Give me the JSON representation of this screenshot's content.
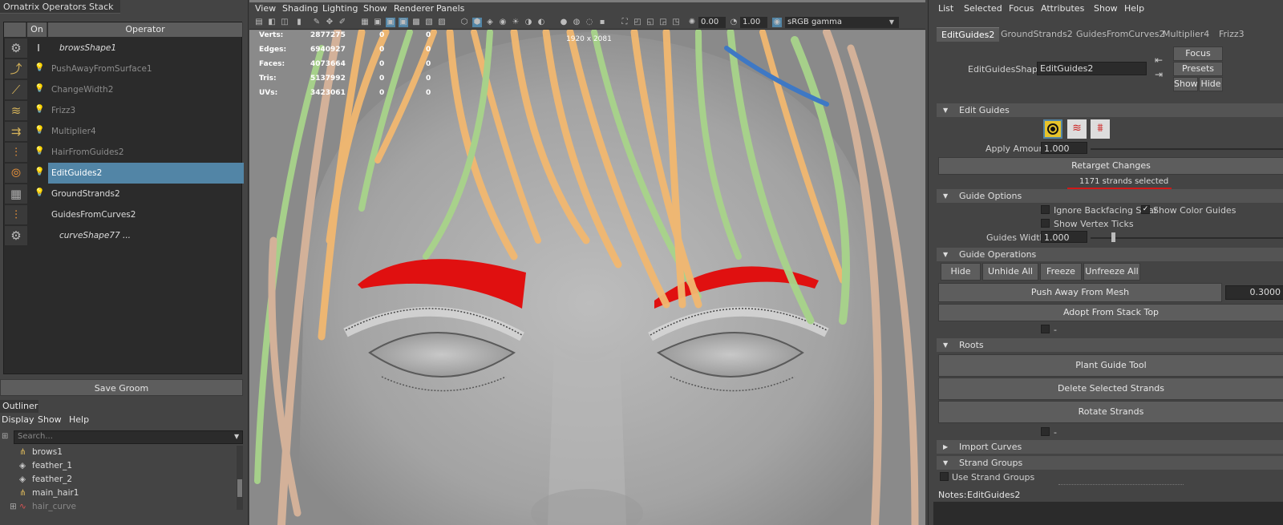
{
  "stack": {
    "title": "Ornatrix Operators Stack",
    "col_on": "On",
    "col_operator": "Operator",
    "rows": [
      {
        "name": "browsShape1",
        "icon": "gear-icon"
      },
      {
        "name": "PushAwayFromSurface1",
        "icon": "push-away-icon"
      },
      {
        "name": "ChangeWidth2",
        "icon": "change-width-icon"
      },
      {
        "name": "Frizz3",
        "icon": "frizz-icon"
      },
      {
        "name": "Multiplier4",
        "icon": "multiplier-icon"
      },
      {
        "name": "HairFromGuides2",
        "icon": "hair-from-guides-icon"
      },
      {
        "name": "EditGuides2",
        "icon": "edit-guides-icon"
      },
      {
        "name": "GroundStrands2",
        "icon": "ground-strands-icon"
      },
      {
        "name": "GuidesFromCurves2",
        "icon": "guides-from-curves-icon"
      },
      {
        "name": "curveShape77 ...",
        "icon": "gear-icon"
      }
    ],
    "save_groom": "Save Groom"
  },
  "outliner": {
    "title": "Outliner",
    "menu": [
      "Display",
      "Show",
      "Help"
    ],
    "search_placeholder": "Search...",
    "items": [
      "brows1",
      "feather_1",
      "feather_2",
      "main_hair1",
      "hair_curve"
    ]
  },
  "viewport": {
    "menu": [
      "View",
      "Shading",
      "Lighting",
      "Show",
      "Renderer",
      "Panels"
    ],
    "exposure": "0.00",
    "gamma": "1.00",
    "color_space": "sRGB gamma",
    "resolution": "1920 x 2081",
    "hud": [
      {
        "label": "Verts:",
        "value": "2877275",
        "c1": "0",
        "c2": "0"
      },
      {
        "label": "Edges:",
        "value": "6940927",
        "c1": "0",
        "c2": "0"
      },
      {
        "label": "Faces:",
        "value": "4073664",
        "c1": "0",
        "c2": "0"
      },
      {
        "label": "Tris:",
        "value": "5137992",
        "c1": "0",
        "c2": "0"
      },
      {
        "label": "UVs:",
        "value": "3423061",
        "c1": "0",
        "c2": "0"
      }
    ]
  },
  "attr": {
    "menu": [
      "List",
      "Selected",
      "Focus",
      "Attributes",
      "Show",
      "Help"
    ],
    "tabs": [
      "EditGuides2",
      "GroundStrands2",
      "GuidesFromCurves2",
      "Multiplier4",
      "Frizz3"
    ],
    "shape_label": "EditGuidesShape:",
    "shape_value": "EditGuides2",
    "focus": "Focus",
    "presets": "Presets",
    "show": "Show",
    "hide": "Hide",
    "edit_guides": {
      "title": "Edit Guides",
      "apply_amount_label": "Apply Amount",
      "apply_amount": "1.000",
      "retarget": "Retarget Changes",
      "selected_info": "1171 strands selected"
    },
    "guide_options": {
      "title": "Guide Options",
      "ignore_backfacing": "Ignore Backfacing Strar",
      "show_color_guides": "Show Color Guides",
      "show_vertex_ticks": "Show Vertex Ticks",
      "guides_width_label": "Guides Width",
      "guides_width": "1.000"
    },
    "guide_operations": {
      "title": "Guide Operations",
      "hide": "Hide",
      "unhide_all": "Unhide All",
      "freeze": "Freeze",
      "unfreeze_all": "Unfreeze All",
      "push_away": "Push Away From Mesh",
      "push_value": "0.3000",
      "adopt": "Adopt From Stack Top",
      "dash": "-"
    },
    "roots": {
      "title": "Roots",
      "plant": "Plant Guide Tool",
      "delete": "Delete Selected Strands",
      "rotate": "Rotate Strands",
      "dash": "-"
    },
    "import_curves": "Import Curves",
    "strand_groups": {
      "title": "Strand Groups",
      "use": "Use Strand Groups"
    },
    "notes_label": "Notes:",
    "notes_value": "EditGuides2"
  }
}
